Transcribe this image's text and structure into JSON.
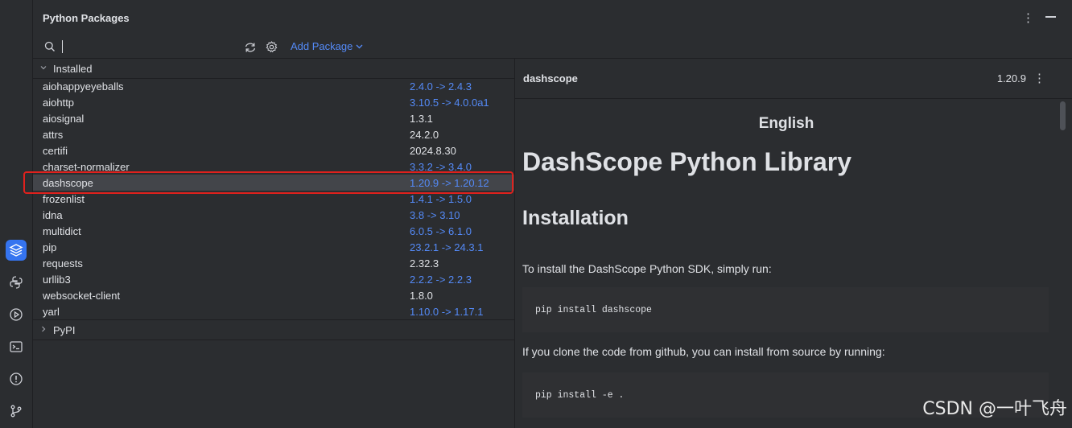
{
  "panel": {
    "title": "Python Packages"
  },
  "header": {
    "more_icon": "more-vertical-icon",
    "minimize_icon": "minimize-icon"
  },
  "toolbar": {
    "search_value": "",
    "search_placeholder": "",
    "add_package_label": "Add Package"
  },
  "tree": {
    "installed_label": "Installed",
    "pypi_label": "PyPI",
    "packages": [
      {
        "name": "aiohappyeyeballs",
        "version": "2.4.0 -> 2.4.3",
        "update": true
      },
      {
        "name": "aiohttp",
        "version": "3.10.5 -> 4.0.0a1",
        "update": true
      },
      {
        "name": "aiosignal",
        "version": "1.3.1",
        "update": false
      },
      {
        "name": "attrs",
        "version": "24.2.0",
        "update": false
      },
      {
        "name": "certifi",
        "version": "2024.8.30",
        "update": false
      },
      {
        "name": "charset-normalizer",
        "version": "3.3.2 -> 3.4.0",
        "update": true
      },
      {
        "name": "dashscope",
        "version": "1.20.9 -> 1.20.12",
        "update": true,
        "selected": true
      },
      {
        "name": "frozenlist",
        "version": "1.4.1 -> 1.5.0",
        "update": true
      },
      {
        "name": "idna",
        "version": "3.8 -> 3.10",
        "update": true
      },
      {
        "name": "multidict",
        "version": "6.0.5 -> 6.1.0",
        "update": true
      },
      {
        "name": "pip",
        "version": "23.2.1 -> 24.3.1",
        "update": true
      },
      {
        "name": "requests",
        "version": "2.32.3",
        "update": false
      },
      {
        "name": "urllib3",
        "version": "2.2.2 -> 2.2.3",
        "update": true
      },
      {
        "name": "websocket-client",
        "version": "1.8.0",
        "update": false
      },
      {
        "name": "yarl",
        "version": "1.10.0 -> 1.17.1",
        "update": true
      }
    ]
  },
  "detail": {
    "name": "dashscope",
    "version": "1.20.9",
    "doc": {
      "lang_link": "English",
      "h1": "DashScope Python Library",
      "h2": "Installation",
      "p1": "To install the DashScope Python SDK, simply run:",
      "code1": "pip install dashscope",
      "p2": "If you clone the code from github, you can install from source by running:",
      "code2": "pip install -e ."
    }
  },
  "watermark": "CSDN @一叶飞舟",
  "colors": {
    "accent": "#3574f0",
    "link": "#548af7",
    "highlight": "#e0211d",
    "background": "#2b2d30"
  }
}
